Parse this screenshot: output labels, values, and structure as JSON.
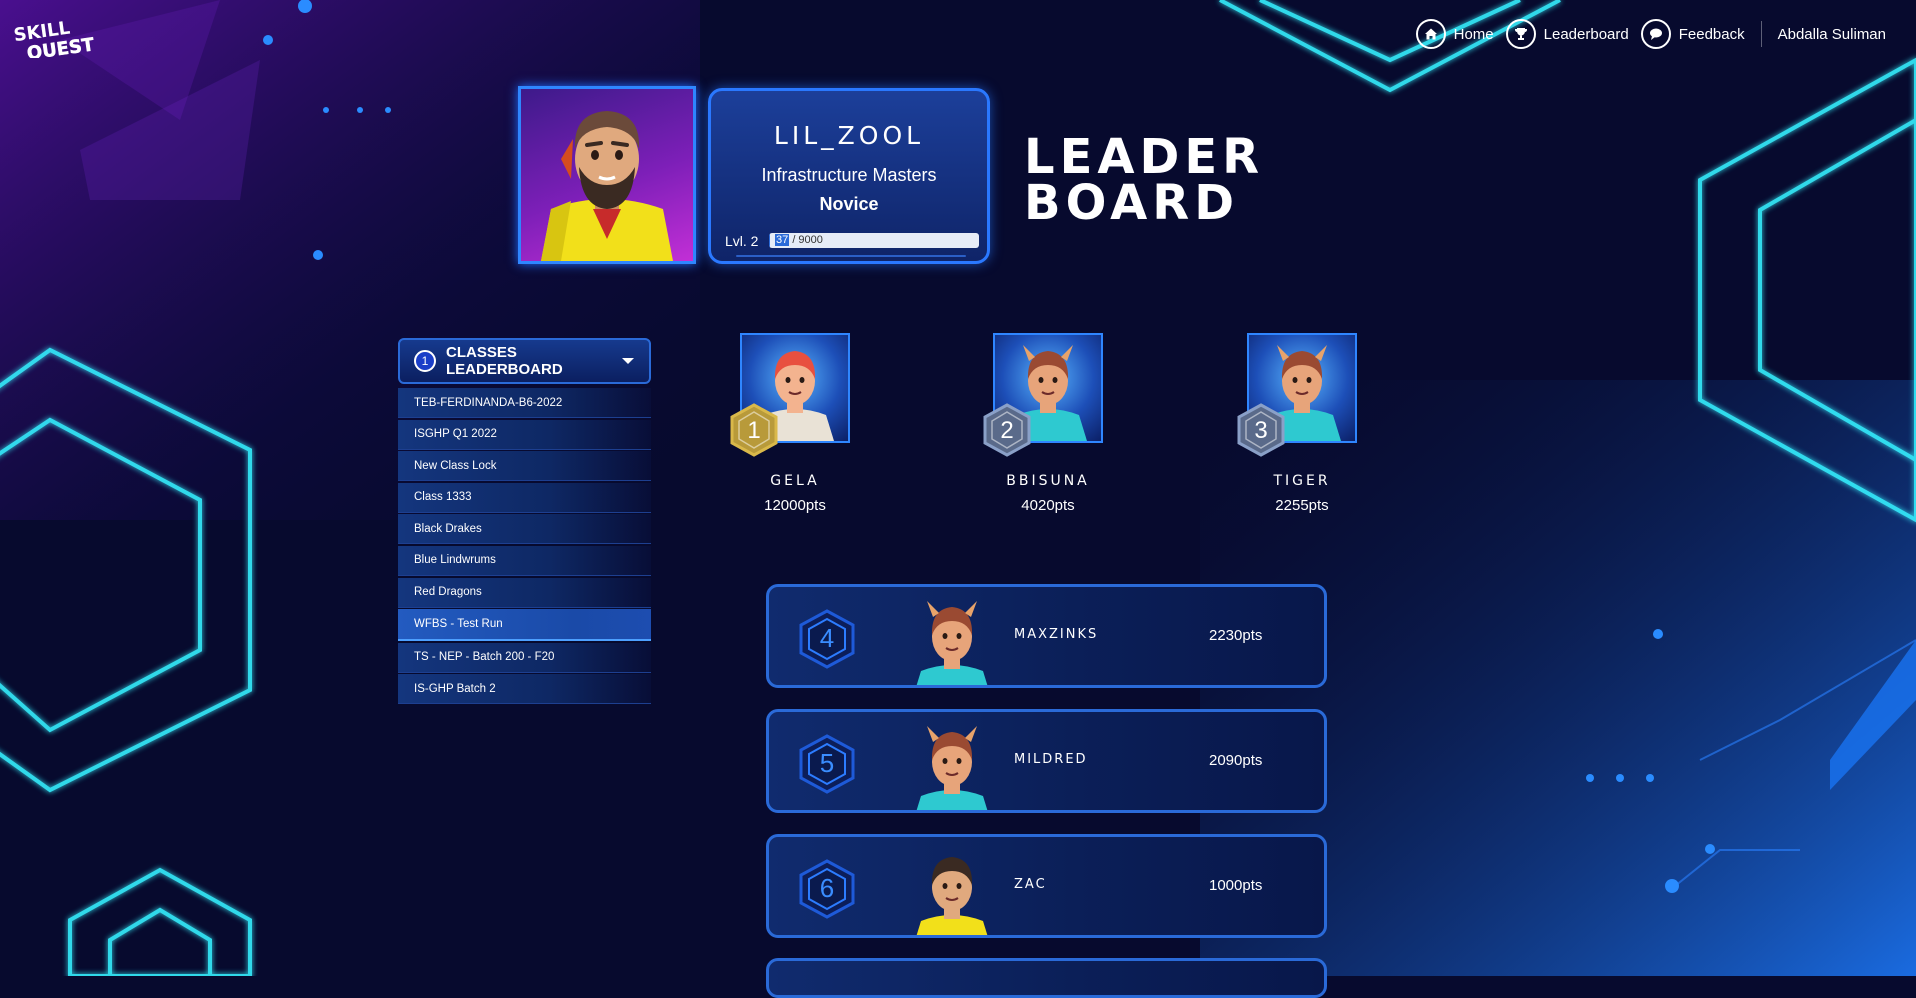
{
  "app": {
    "logo_line1": "SKILL",
    "logo_line2": "QUEST"
  },
  "nav": {
    "items": [
      {
        "label": "Home",
        "icon": "home-icon"
      },
      {
        "label": "Leaderboard",
        "icon": "trophy-icon"
      },
      {
        "label": "Feedback",
        "icon": "chat-icon"
      }
    ],
    "user": "Abdalla Suliman"
  },
  "profile": {
    "username": "LIL_ZOOL",
    "class_name": "Infrastructure Masters",
    "rank": "Novice",
    "level": "Lvl. 2",
    "xp_current": "37",
    "xp_total": "/ 9000",
    "xp_fraction": 0.0041
  },
  "page_title": {
    "line1": "LEADER",
    "line2": "BOARD"
  },
  "class_dropdown": {
    "number": "1",
    "label": "CLASSES LEADERBOARD",
    "items": [
      "TEB-FERDINANDA-B6-2022",
      "ISGHP Q1 2022",
      "New Class Lock",
      "Class 1333",
      "Black Drakes",
      "Blue Lindwrums",
      "Red Dragons",
      "WFBS - Test Run",
      "TS - NEP - Batch 200 - F20",
      "IS-GHP Batch 2"
    ],
    "active_index": 7
  },
  "podium": [
    {
      "rank": "1",
      "name": "GELA",
      "points": "12000pts"
    },
    {
      "rank": "2",
      "name": "BBISUNA",
      "points": "4020pts"
    },
    {
      "rank": "3",
      "name": "TIGER",
      "points": "2255pts"
    }
  ],
  "rankings": [
    {
      "rank": "4",
      "name": "MAXZINKS",
      "points": "2230pts"
    },
    {
      "rank": "5",
      "name": "MILDRED",
      "points": "2090pts"
    },
    {
      "rank": "6",
      "name": "ZAC",
      "points": "1000pts"
    }
  ],
  "colors": {
    "background": "#070a2e",
    "neon_cyan": "#36f0ff",
    "accent_blue": "#2a6ad8",
    "gold": "#d9b84a"
  }
}
